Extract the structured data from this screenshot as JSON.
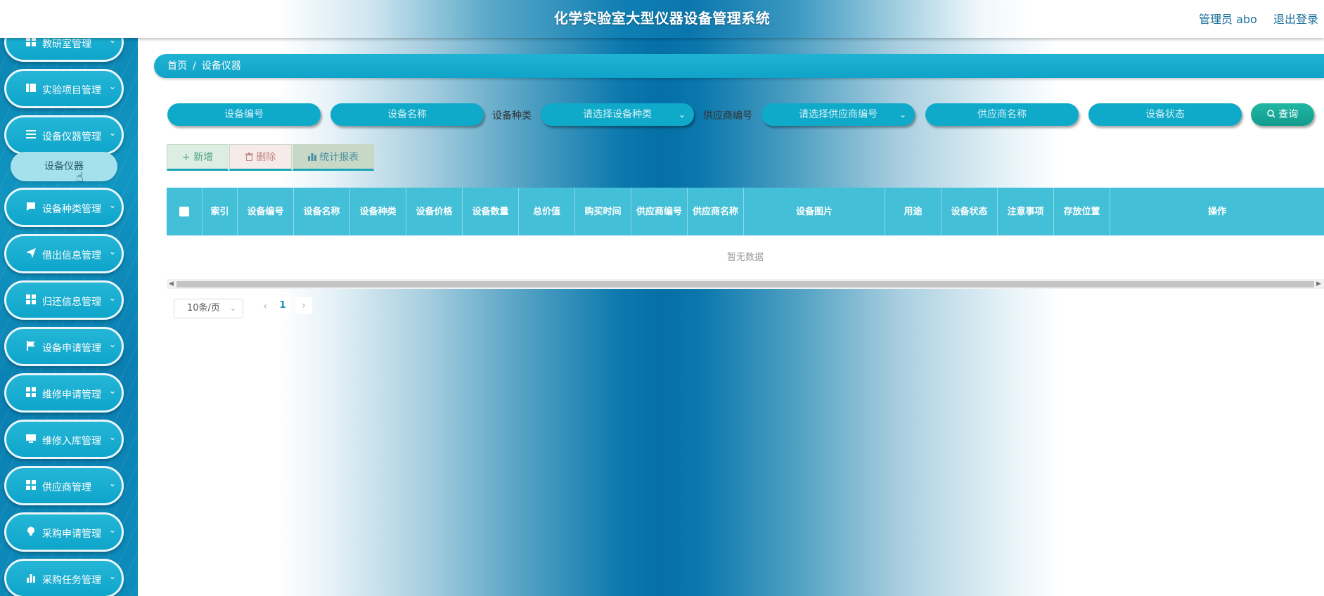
{
  "header": {
    "title": "化学实验室大型仪器设备管理系统",
    "user_label": "管理员 abo",
    "logout_label": "退出登录"
  },
  "sidebar": {
    "items": [
      {
        "label": "教研室管理",
        "icon": "grid-icon"
      },
      {
        "label": "实验项目管理",
        "icon": "book-icon"
      },
      {
        "label": "设备仪器管理",
        "icon": "list-icon"
      },
      {
        "label": "设备种类管理",
        "icon": "chat-icon"
      },
      {
        "label": "借出信息管理",
        "icon": "send-icon"
      },
      {
        "label": "归还信息管理",
        "icon": "grid-icon"
      },
      {
        "label": "设备申请管理",
        "icon": "flag-icon"
      },
      {
        "label": "维修申请管理",
        "icon": "grid-icon"
      },
      {
        "label": "维修入库管理",
        "icon": "monitor-icon"
      },
      {
        "label": "供应商管理",
        "icon": "grid-icon"
      },
      {
        "label": "采购申请管理",
        "icon": "bulb-icon"
      },
      {
        "label": "采购任务管理",
        "icon": "chart-icon"
      }
    ],
    "active_sub_item": "设备仪器"
  },
  "breadcrumb": {
    "home": "首页",
    "separator": "/",
    "current": "设备仪器"
  },
  "search": {
    "device_no_placeholder": "设备编号",
    "device_name_placeholder": "设备名称",
    "category_label": "设备种类",
    "category_placeholder": "请选择设备种类",
    "supplier_no_label": "供应商编号",
    "supplier_no_placeholder": "请选择供应商编号",
    "supplier_name_placeholder": "供应商名称",
    "status_placeholder": "设备状态",
    "query_label": "查询"
  },
  "toolbar": {
    "add_label": "新增",
    "delete_label": "删除",
    "report_label": "统计报表"
  },
  "table": {
    "columns": [
      "索引",
      "设备编号",
      "设备名称",
      "设备种类",
      "设备价格",
      "设备数量",
      "总价值",
      "购买时间",
      "供应商编号",
      "供应商名称",
      "设备图片",
      "用途",
      "设备状态",
      "注意事项",
      "存放位置",
      "操作"
    ],
    "empty_text": "暂无数据"
  },
  "pagination": {
    "page_size": "10条/页",
    "current_page": "1"
  },
  "colors": {
    "accent": "#10a3c9",
    "header_row": "#43bfd7",
    "query_button": "#18a997"
  }
}
